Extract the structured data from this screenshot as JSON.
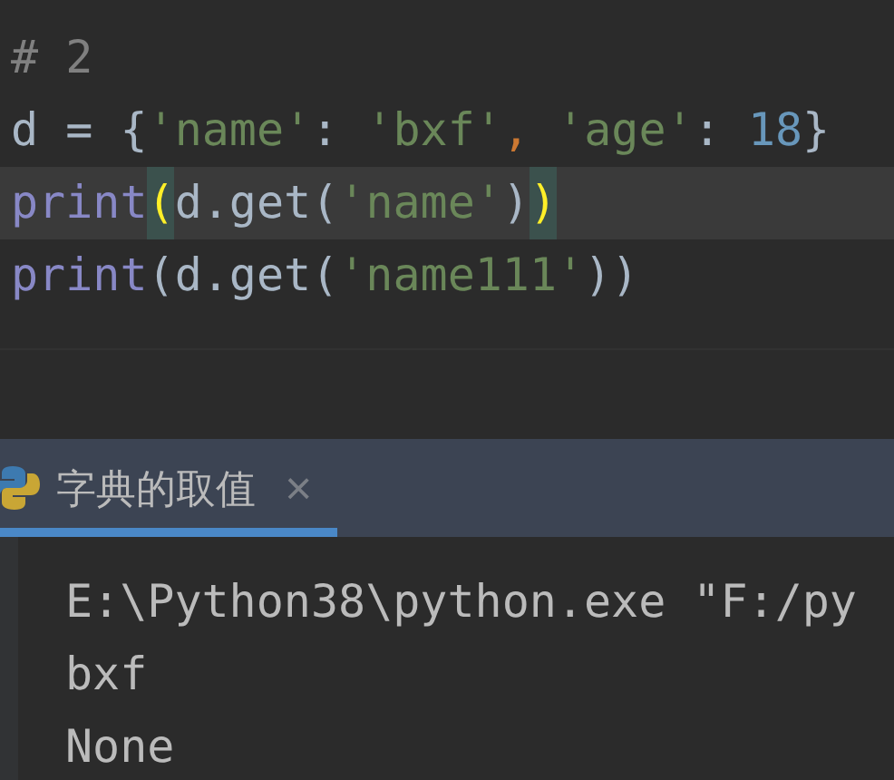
{
  "editor": {
    "lines": [
      {
        "current": false,
        "tokens": [
          {
            "kind": "comment",
            "text": "# 2"
          }
        ]
      },
      {
        "current": false,
        "tokens": [
          {
            "kind": "plain",
            "text": "d = {"
          },
          {
            "kind": "string",
            "text": "'name'"
          },
          {
            "kind": "plain",
            "text": ": "
          },
          {
            "kind": "string",
            "text": "'bxf'"
          },
          {
            "kind": "comma",
            "text": ", "
          },
          {
            "kind": "string",
            "text": "'age'"
          },
          {
            "kind": "plain",
            "text": ": "
          },
          {
            "kind": "number",
            "text": "18"
          },
          {
            "kind": "plain",
            "text": "}"
          }
        ]
      },
      {
        "current": true,
        "tokens": [
          {
            "kind": "builtin",
            "text": "print"
          },
          {
            "kind": "match",
            "text": "("
          },
          {
            "kind": "plain",
            "text": "d.get("
          },
          {
            "kind": "string",
            "text": "'name'"
          },
          {
            "kind": "plain",
            "text": ")"
          },
          {
            "kind": "match",
            "text": ")"
          }
        ]
      },
      {
        "current": false,
        "tokens": [
          {
            "kind": "builtin",
            "text": "print"
          },
          {
            "kind": "plain",
            "text": "(d.get("
          },
          {
            "kind": "string",
            "text": "'name111'"
          },
          {
            "kind": "plain",
            "text": "))"
          }
        ]
      }
    ]
  },
  "run_tabs": [
    {
      "label": "字典的取值",
      "close": "×",
      "selected": true
    }
  ],
  "console": {
    "lines": [
      "E:\\Python38\\python.exe \"F:/py",
      "bxf",
      "None"
    ]
  }
}
